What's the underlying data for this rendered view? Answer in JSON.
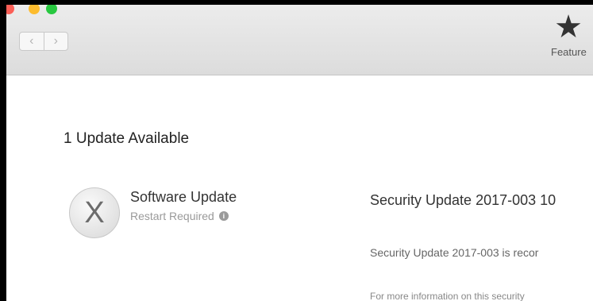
{
  "toolbar": {
    "nav_back": "‹",
    "nav_forward": "›",
    "featured_label": "Feature",
    "featured_icon": "★"
  },
  "main": {
    "heading": "1 Update Available",
    "update": {
      "icon_glyph": "X",
      "title": "Software Update",
      "subtitle": "Restart Required",
      "detail_title": "Security Update 2017-003 10",
      "detail_desc": "Security Update 2017-003 is recor",
      "detail_more": "For more information on this security"
    }
  },
  "colors": {
    "close": "#fc5f57",
    "minimize": "#fdbc2e",
    "maximize": "#28c840"
  }
}
